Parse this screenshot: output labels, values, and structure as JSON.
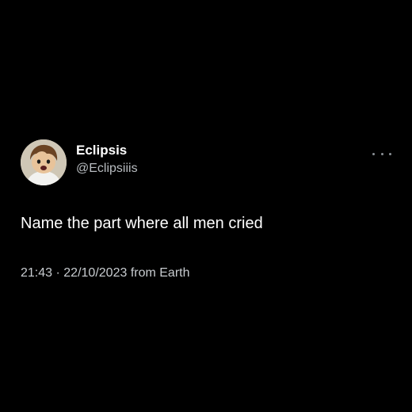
{
  "user": {
    "display_name": "Eclipsis",
    "handle": "@Eclipsiiis",
    "avatar_icon": "cartoon-avatar-icon"
  },
  "tweet": {
    "text": "Name the part where all men cried",
    "time": "21:43",
    "separator": "·",
    "date": "22/10/2023",
    "source": "from Earth"
  },
  "menu": {
    "icon": "more-options-icon"
  },
  "colors": {
    "background": "#000000",
    "primary_text": "#ffffff",
    "secondary_text": "#b8bcc0"
  }
}
